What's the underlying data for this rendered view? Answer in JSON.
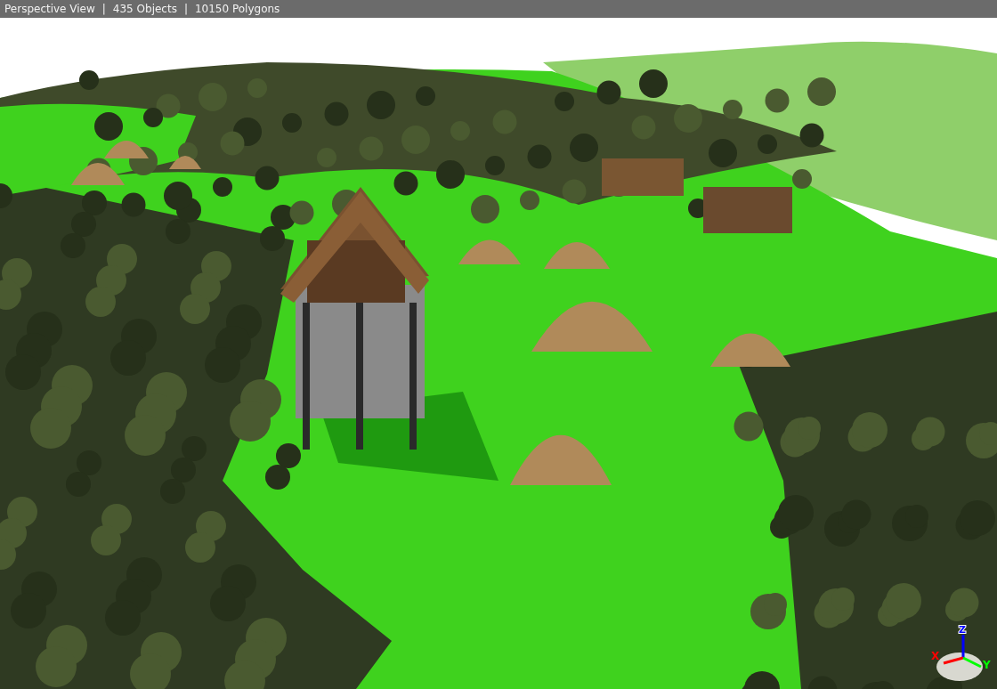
{
  "status_bar": {
    "items": [
      {
        "kind": "text",
        "text": "Perspective View"
      },
      {
        "kind": "separator",
        "text": "|"
      },
      {
        "kind": "text",
        "text": "435 Objects"
      },
      {
        "kind": "separator",
        "text": "|"
      },
      {
        "kind": "text",
        "text": "10150 Polygons"
      }
    ]
  },
  "axis_gizmo": {
    "axes": [
      {
        "label": "X",
        "color": "#ff0000"
      },
      {
        "label": "Y",
        "color": "#00ff00"
      },
      {
        "label": "Z",
        "color": "#0000ff"
      }
    ]
  }
}
